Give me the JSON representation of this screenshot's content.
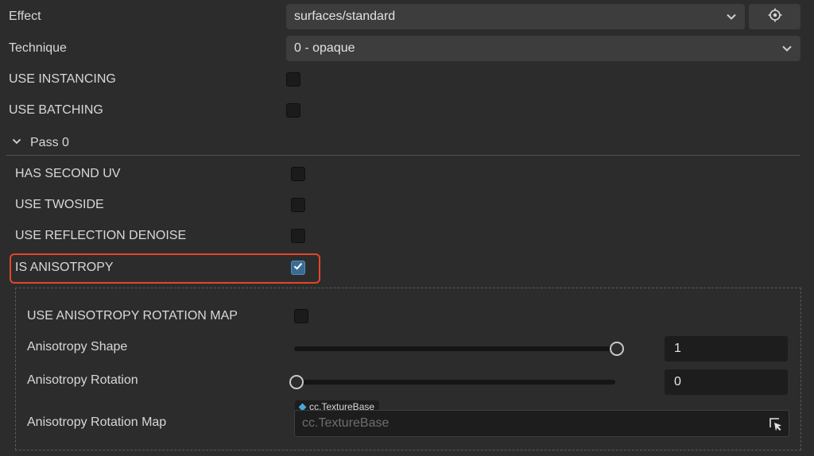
{
  "rows": {
    "effect": {
      "label": "Effect",
      "value": "surfaces/standard"
    },
    "technique": {
      "label": "Technique",
      "value": "0 - opaque"
    },
    "use_instancing": {
      "label": "USE INSTANCING",
      "checked": false
    },
    "use_batching": {
      "label": "USE BATCHING",
      "checked": false
    }
  },
  "pass": {
    "title": "Pass 0",
    "expanded": true,
    "items": {
      "has_second_uv": {
        "label": "HAS SECOND UV",
        "checked": false
      },
      "use_twoside": {
        "label": "USE TWOSIDE",
        "checked": false
      },
      "use_reflection_denoise": {
        "label": "USE REFLECTION DENOISE",
        "checked": false
      },
      "is_anisotropy": {
        "label": "IS ANISOTROPY",
        "checked": true
      }
    },
    "anisotropy": {
      "use_rotation_map": {
        "label": "USE ANISOTROPY ROTATION MAP",
        "checked": false
      },
      "shape": {
        "label": "Anisotropy Shape",
        "value": "1",
        "slider_fraction": 1.0
      },
      "rotation": {
        "label": "Anisotropy Rotation",
        "value": "0",
        "slider_fraction": 0.0
      },
      "rotation_map": {
        "label": "Anisotropy Rotation Map",
        "type_tag": "cc.TextureBase",
        "placeholder": "cc.TextureBase"
      }
    }
  },
  "colors": {
    "highlight": "#e5462a",
    "asset_diamond": "#4aa6d9",
    "checkbox_checked": "#3a6b93"
  },
  "icons": {
    "locate": "crosshair-icon",
    "dropdown": "chevron-down-icon",
    "collapse": "chevron-down-icon",
    "asset_pick": "pick-cursor-icon"
  }
}
